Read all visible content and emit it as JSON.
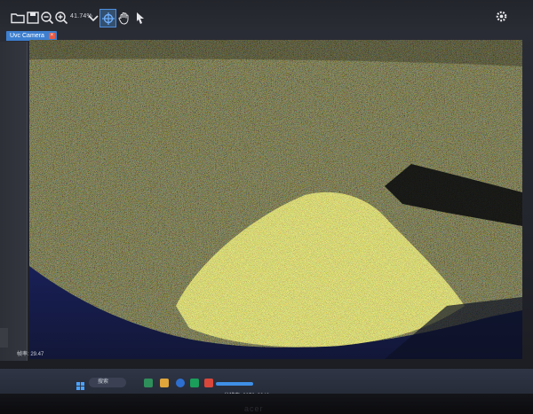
{
  "toolbar": {
    "zoom_level": "41.74%",
    "icons": [
      "open-folder-icon",
      "save-icon",
      "zoom-out-icon",
      "zoom-in-icon",
      "chevron-down-icon",
      "crosshair-icon",
      "hand-icon",
      "pointer-icon",
      "gear-icon"
    ]
  },
  "tabs": [
    {
      "label": "Uvc Camera",
      "active": true
    }
  ],
  "status": {
    "left_text": "帧率: 29.47",
    "resolution_text": "分辨率: 3072x2048"
  },
  "taskbar": {
    "search_label": "搜索"
  },
  "colors": {
    "accent": "#3d7fd0",
    "tab_close": "#e95b45",
    "crosshair": "#4c8fe0"
  }
}
